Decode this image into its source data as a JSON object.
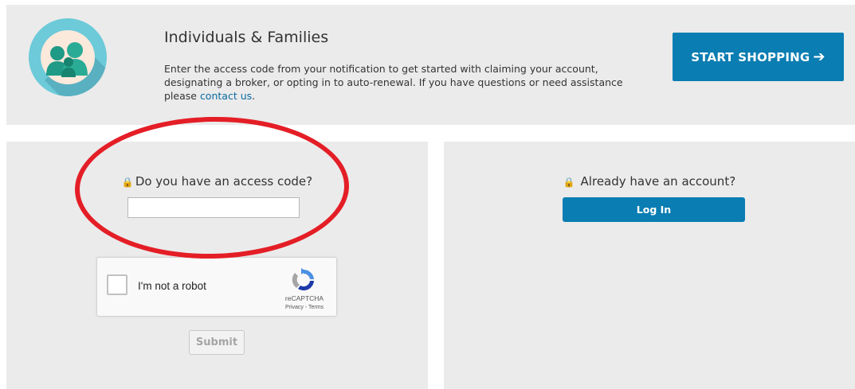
{
  "banner": {
    "title": "Individuals & Families",
    "text_prefix": "Enter the access code from your notification to get started with claiming your account, designating a broker, or opting in to auto-renewal. If you have questions or need assistance please ",
    "contact_link": "contact us",
    "text_suffix": ".",
    "start_shopping_label": "START SHOPPING",
    "start_shopping_arrow": "➔"
  },
  "access_code": {
    "lock_glyph": "🔒",
    "label": "Do you have an access code?",
    "input_value": "",
    "input_placeholder": ""
  },
  "captcha": {
    "checkbox_label": "I'm not a robot",
    "brand": "reCAPTCHA",
    "links": "Privacy - Terms"
  },
  "submit": {
    "label": "Submit"
  },
  "account": {
    "lock_glyph": "🔒",
    "label": "Already have an account?",
    "login_label": "Log In"
  },
  "colors": {
    "primary": "#0a7db2",
    "panel_bg": "#ebebeb",
    "link": "#0a6aa1",
    "annotation_red": "#e41e26"
  }
}
